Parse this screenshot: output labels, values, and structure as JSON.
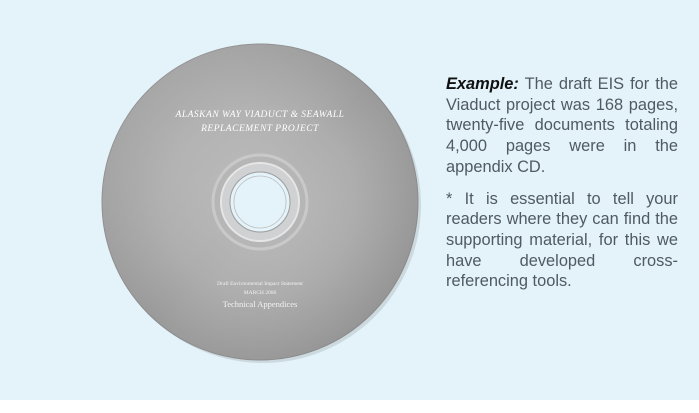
{
  "disc": {
    "title_line1": "ALASKAN WAY VIADUCT & SEAWALL",
    "title_line2": "REPLACEMENT PROJECT",
    "subtitle": "Draft Environmental Impact Statement",
    "date": "MARCH 2006",
    "label": "Technical Appendices"
  },
  "content": {
    "lead": "Example:",
    "paragraph1": "The draft EIS for the Viaduct project was 168 pages, twenty-five documents totaling 4,000 pages were in the appendix CD.",
    "paragraph2": "* It is essential to tell your readers where they can find the supporting material, for this we have developed cross-referencing tools."
  }
}
